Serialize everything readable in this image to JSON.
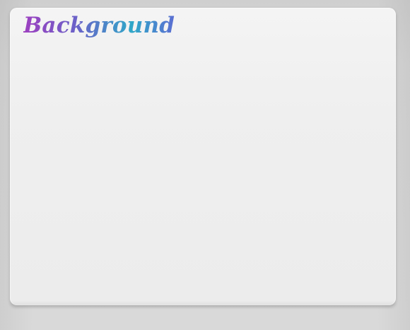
{
  "slide": {
    "title": "Background"
  }
}
